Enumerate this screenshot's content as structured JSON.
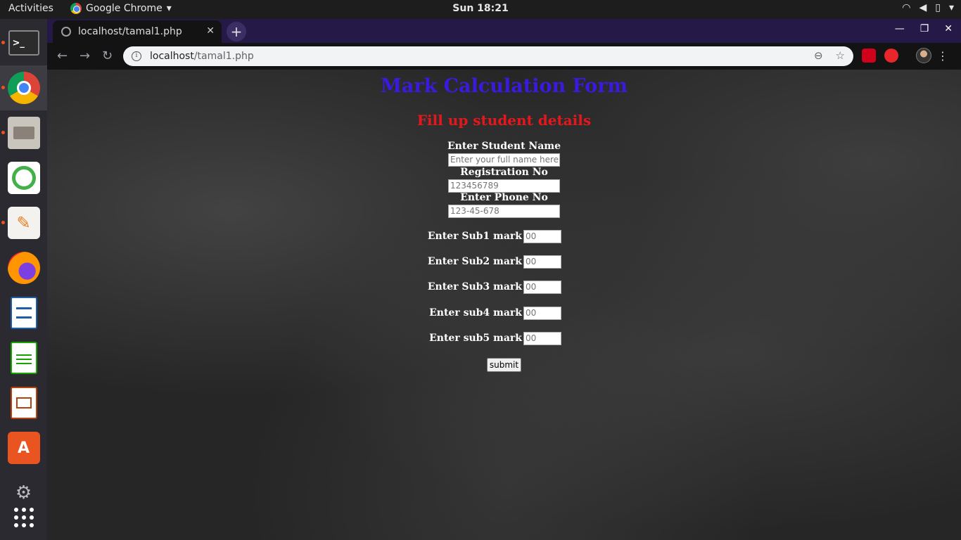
{
  "topbar": {
    "activities": "Activities",
    "app_name": "Google Chrome",
    "clock": "Sun 18:21"
  },
  "dock": {
    "items": [
      "terminal-icon",
      "chrome-icon",
      "file-manager-icon",
      "anaconda-navigator-icon",
      "text-editor-icon",
      "firefox-icon",
      "writer-icon",
      "calc-icon",
      "impress-icon",
      "software-center-icon",
      "settings-tools-icon",
      "show-apps-icon"
    ]
  },
  "browser": {
    "tab_title": "localhost/tamal1.php",
    "url_host": "localhost",
    "url_path": "/tamal1.php"
  },
  "page": {
    "title": "Mark Calculation Form",
    "subtitle": "Fill up student details",
    "name_label": "Enter Student Name",
    "name_placeholder": "Enter your full name here",
    "reg_label": "Registration No",
    "reg_placeholder": "123456789",
    "phone_label": "Enter Phone No",
    "phone_placeholder": "123-45-678",
    "marks": [
      {
        "label": "Enter Sub1 mark",
        "placeholder": "00"
      },
      {
        "label": "Enter Sub2 mark",
        "placeholder": "00"
      },
      {
        "label": "Enter Sub3 mark",
        "placeholder": "00"
      },
      {
        "label": "Enter sub4 mark",
        "placeholder": "00"
      },
      {
        "label": "Enter sub5 mark",
        "placeholder": "00"
      }
    ],
    "submit_label": "submit"
  },
  "colors": {
    "title": "#3b1ae0",
    "subtitle": "#e4181c",
    "tabstrip": "#251a47"
  }
}
